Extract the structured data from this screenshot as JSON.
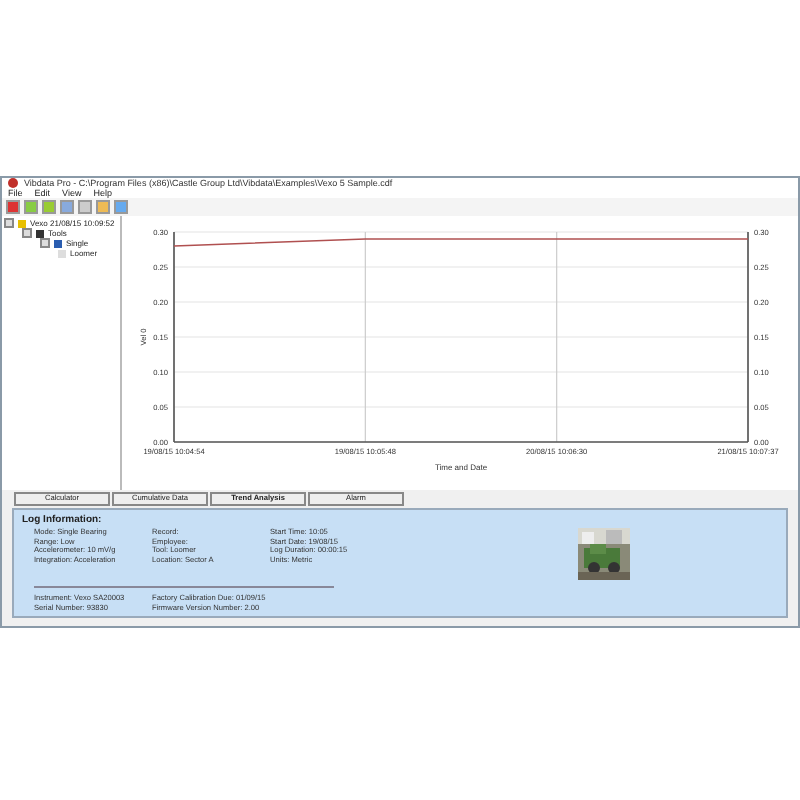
{
  "window": {
    "title": "Vibdata Pro - C:\\Program Files (x86)\\Castle Group Ltd\\Vibdata\\Examples\\Vexo 5 Sample.cdf"
  },
  "menu": [
    "File",
    "Edit",
    "View",
    "Help"
  ],
  "tree": [
    {
      "label": "Vexo 21/08/15 10:09:52",
      "expanded": true,
      "children": [
        {
          "label": "Tools",
          "expanded": true,
          "children": [
            {
              "label": "Single",
              "expanded": true,
              "children": [
                {
                  "label": "Loomer"
                }
              ]
            }
          ]
        }
      ]
    }
  ],
  "chart": {
    "chart_data": {
      "type": "line",
      "xlabel": "Time and Date",
      "ylabel": "Vel 0",
      "x": [
        "19/08/15 10:04:54",
        "19/08/15 10:05:48",
        "20/08/15 10:06:30",
        "21/08/15 10:07:37"
      ],
      "ylim": [
        0,
        0.3
      ],
      "yticks": [
        {
          "value": 0,
          "label": "0.00"
        },
        {
          "value": 0.05,
          "label": "0.05"
        },
        {
          "value": 0.1,
          "label": "0.10"
        },
        {
          "value": 0.15,
          "label": "0.15"
        },
        {
          "value": 0.2,
          "label": "0.20"
        },
        {
          "value": 0.25,
          "label": "0.25"
        },
        {
          "value": 0.3,
          "label": "0.30"
        }
      ],
      "grid": true,
      "series": [
        {
          "color": "#b05050",
          "values": [
            0.28,
            0.29,
            0.29,
            0.29
          ]
        }
      ]
    }
  },
  "tabs": [
    {
      "label": "Calculator",
      "selected": false
    },
    {
      "label": "Cumulative Data",
      "selected": false
    },
    {
      "label": "Trend Analysis",
      "selected": true
    },
    {
      "label": "Alarm",
      "selected": false
    }
  ],
  "log": {
    "heading": "Log Information:",
    "columns": [
      [
        "Mode: Single Bearing",
        "Range: Low",
        "Accelerometer: 10 mV/g",
        "Integration: Acceleration"
      ],
      [
        "Record:",
        "Employee:",
        "Tool: Loomer",
        "Location: Sector A"
      ],
      [
        "Start Time: 10:05",
        "Start Date: 19/08/15",
        "Log Duration: 00:00:15",
        "Units: Metric"
      ]
    ],
    "footer": [
      [
        "Instrument: Vexo SA20003",
        "Serial Number: 93830"
      ],
      [
        "Factory Calibration Due: 01/09/15",
        "Firmware Version Number: 2.00"
      ]
    ],
    "photo": {
      "kind": "picture"
    }
  }
}
